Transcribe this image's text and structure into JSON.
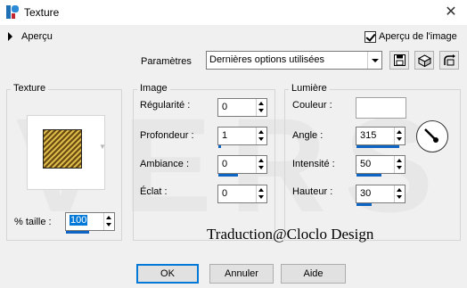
{
  "window": {
    "title": "Texture",
    "close_glyph": "✕"
  },
  "preview": {
    "toggle_label": "Aperçu",
    "image_preview_label": "Aperçu de l'image",
    "image_preview_checked": true
  },
  "presets": {
    "label": "Paramètres",
    "value": "Dernières options utilisées",
    "tools": [
      "save-preset-icon",
      "reset-icon",
      "randomize-icon"
    ]
  },
  "texture_group": {
    "title": "Texture",
    "size_label": "% taille :",
    "size_value": "100"
  },
  "image_group": {
    "title": "Image",
    "fields": [
      {
        "label": "Régularité :",
        "value": "0"
      },
      {
        "label": "Profondeur :",
        "value": "1"
      },
      {
        "label": "Ambiance :",
        "value": "0"
      },
      {
        "label": "Éclat :",
        "value": "0"
      }
    ]
  },
  "light_group": {
    "title": "Lumière",
    "color_label": "Couleur :",
    "color_value": "#ffffff",
    "fields": [
      {
        "label": "Angle :",
        "value": "315"
      },
      {
        "label": "Intensité :",
        "value": "50"
      },
      {
        "label": "Hauteur :",
        "value": "30"
      }
    ]
  },
  "watermark": "VERS",
  "credit": "Traduction@Cloclo Design",
  "buttons": {
    "ok": "OK",
    "cancel": "Annuler",
    "help": "Aide"
  }
}
